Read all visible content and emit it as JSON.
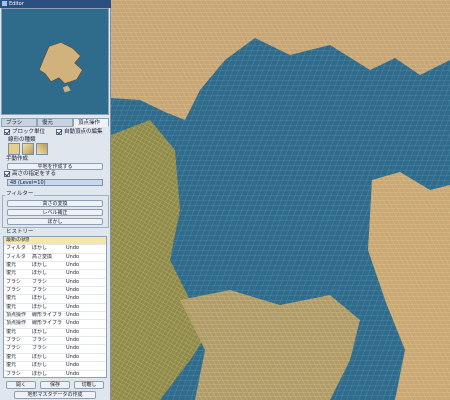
{
  "window": {
    "title": "Editor"
  },
  "tabs": [
    {
      "label": "ブラシ"
    },
    {
      "label": "復元"
    },
    {
      "label": "頂点操作"
    }
  ],
  "brush": {
    "block_unit_label": "ブロック単位",
    "block_unit_checked": true,
    "auto_vertex_label": "自動頂点の編集",
    "auto_vertex_checked": true,
    "stroke_type_label": "線形の種類",
    "hand_label": "手動作成",
    "create_button": "平地を作成する",
    "height_label": "高さの指定をする",
    "height_checked": true,
    "height_value": "48 (Level=10)"
  },
  "filter": {
    "label": "フィルター",
    "buttons": [
      "高さの変換",
      "レベル補正",
      "ぼかし"
    ]
  },
  "history": {
    "label": "ヒストリー",
    "header": "最新の状態",
    "rows": [
      [
        "フィルタ",
        "ぼかし",
        "Undo"
      ],
      [
        "フィルタ",
        "高さ変換",
        "Undo"
      ],
      [
        "復元",
        "ぼかし",
        "Undo"
      ],
      [
        "復元",
        "ぼかし",
        "Undo"
      ],
      [
        "ブラシ",
        "ブラシ",
        "Undo"
      ],
      [
        "ブラシ",
        "ブラシ",
        "Undo"
      ],
      [
        "復元",
        "ぼかし",
        "Undo"
      ],
      [
        "復元",
        "ぼかし",
        "Undo"
      ],
      [
        "頂点操作",
        "線形ライブラ",
        "Undo"
      ],
      [
        "頂点操作",
        "線形ライブラ",
        "Undo"
      ],
      [
        "復元",
        "ぼかし",
        "Undo"
      ],
      [
        "ブラシ",
        "ブラシ",
        "Undo"
      ],
      [
        "ブラシ",
        "ブラシ",
        "Undo"
      ],
      [
        "復元",
        "ぼかし",
        "Undo"
      ],
      [
        "復元",
        "ぼかし",
        "Undo"
      ],
      [
        "ブラシ",
        "ぼかし",
        "Undo"
      ],
      [
        "ブラシ",
        "ぼかし",
        "Undo"
      ],
      [
        "復元",
        "ぼかし",
        "Undo"
      ]
    ],
    "buttons": [
      "開く",
      "保存",
      "切離し"
    ]
  },
  "export_button": "地形マスタデータの作成",
  "colors": {
    "water": "#2f6c8c",
    "land": "#c9a777",
    "wire": "#e6d48a"
  }
}
